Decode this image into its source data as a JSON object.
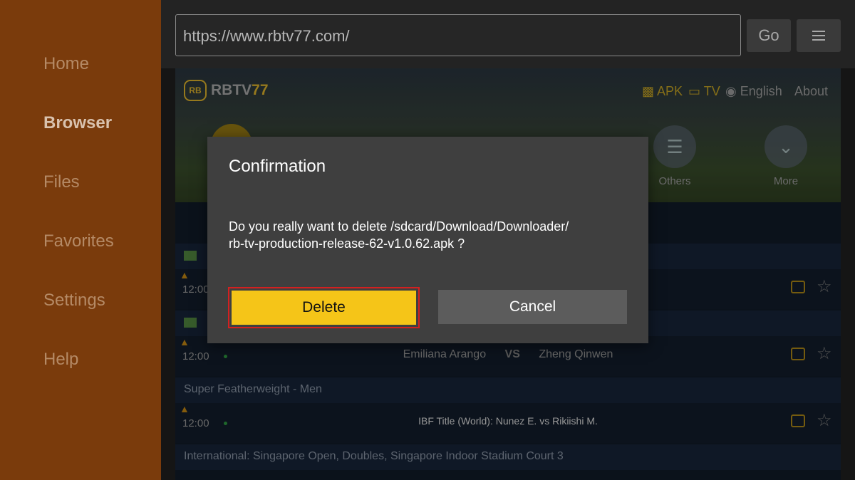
{
  "sidebar": {
    "items": [
      {
        "label": "Home",
        "active": false
      },
      {
        "label": "Browser",
        "active": true
      },
      {
        "label": "Files",
        "active": false
      },
      {
        "label": "Favorites",
        "active": false
      },
      {
        "label": "Settings",
        "active": false
      },
      {
        "label": "Help",
        "active": false
      }
    ]
  },
  "toolbar": {
    "url_value": "https://www.rbtv77.com/",
    "go_label": "Go",
    "menu_icon": "hamburger-menu-icon"
  },
  "site": {
    "logo_badge": "RB",
    "logo_name_a": "RBTV",
    "logo_name_b": "77",
    "header_links": {
      "apk": "APK",
      "tv": "TV",
      "language": "English",
      "about": "About"
    },
    "categories": [
      {
        "label": "Others",
        "icon": "layers-icon"
      },
      {
        "label": "More",
        "icon": "chevron-down-icon"
      }
    ],
    "rows": [
      {
        "title": "Super Featherweight - Men"
      },
      {
        "title": "International: Singapore Open, Doubles, Singapore Indoor Stadium Court 3"
      }
    ],
    "matches": [
      {
        "time": "12:00",
        "home": "",
        "away": ""
      },
      {
        "time": "12:00",
        "home": "Emiliana Arango",
        "vs": "VS",
        "away": "Zheng Qinwen"
      },
      {
        "time": "12:00",
        "title": "IBF Title (World): Nunez E. vs Rikiishi M."
      }
    ]
  },
  "dialog": {
    "title": "Confirmation",
    "message_line1": "Do you really want to delete /sdcard/Download/Downloader/",
    "message_line2": "rb-tv-production-release-62-v1.0.62.apk ?",
    "delete_label": "Delete",
    "cancel_label": "Cancel"
  },
  "colors": {
    "sidebar": "#7a3b0c",
    "accent_yellow": "#f5c518",
    "focus_red": "#d32020"
  }
}
